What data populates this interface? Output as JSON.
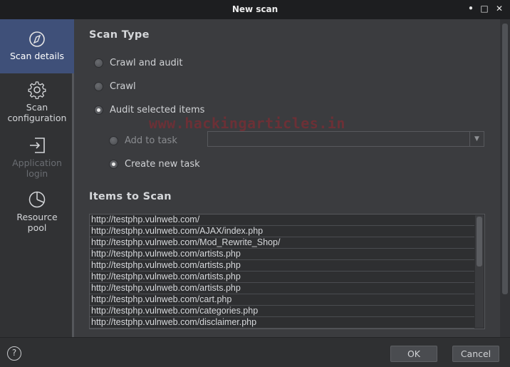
{
  "window": {
    "title": "New scan",
    "minimize_glyph": "•",
    "maximize_glyph": "□",
    "close_glyph": "✕"
  },
  "sidebar": {
    "items": [
      {
        "label": "Scan details",
        "icon": "compass-icon",
        "state": "active"
      },
      {
        "label": "Scan configuration",
        "icon": "gear-icon",
        "state": "normal"
      },
      {
        "label": "Application login",
        "icon": "login-icon",
        "state": "disabled"
      },
      {
        "label": "Resource pool",
        "icon": "pie-chart-icon",
        "state": "normal"
      }
    ]
  },
  "scan_type": {
    "title": "Scan Type",
    "options": [
      {
        "label": "Crawl and audit",
        "selected": false
      },
      {
        "label": "Crawl",
        "selected": false
      },
      {
        "label": "Audit selected items",
        "selected": true
      }
    ],
    "task_options": [
      {
        "label": "Add to task",
        "selected": false
      },
      {
        "label": "Create new task",
        "selected": true
      }
    ],
    "task_combo_value": "",
    "watermark": "www.hackingarticles.in"
  },
  "items_to_scan": {
    "title": "Items to Scan",
    "items": [
      "http://testphp.vulnweb.com/",
      "http://testphp.vulnweb.com/AJAX/index.php",
      "http://testphp.vulnweb.com/Mod_Rewrite_Shop/",
      "http://testphp.vulnweb.com/artists.php",
      "http://testphp.vulnweb.com/artists.php",
      "http://testphp.vulnweb.com/artists.php",
      "http://testphp.vulnweb.com/artists.php",
      "http://testphp.vulnweb.com/cart.php",
      "http://testphp.vulnweb.com/categories.php",
      "http://testphp.vulnweb.com/disclaimer.php"
    ]
  },
  "footer": {
    "help_label": "?",
    "ok_label": "OK",
    "cancel_label": "Cancel"
  },
  "colors": {
    "accent": "#3f5079",
    "background": "#3b3c3f",
    "titlebar": "#1d1e20"
  }
}
